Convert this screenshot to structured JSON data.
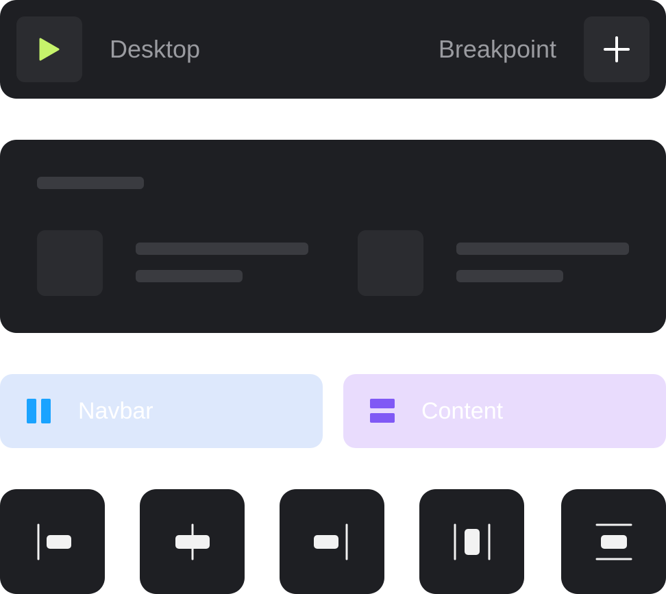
{
  "toolbar": {
    "device_label": "Desktop",
    "breakpoint_label": "Breakpoint",
    "play_icon": "play-icon",
    "add_icon": "plus-icon",
    "play_color": "#c6f36b"
  },
  "layers": [
    {
      "label": "Navbar",
      "icon": "columns-icon",
      "icon_color": "#1aa3ff",
      "bg": "#dde8fc"
    },
    {
      "label": "Content",
      "icon": "rows-icon",
      "icon_color": "#8059f5",
      "bg": "#e9dcfd"
    }
  ],
  "alignment_buttons": [
    {
      "icon": "align-left-icon"
    },
    {
      "icon": "align-center-horizontal-icon"
    },
    {
      "icon": "align-right-icon"
    },
    {
      "icon": "distribute-horizontal-icon"
    },
    {
      "icon": "align-center-vertical-icon"
    }
  ]
}
